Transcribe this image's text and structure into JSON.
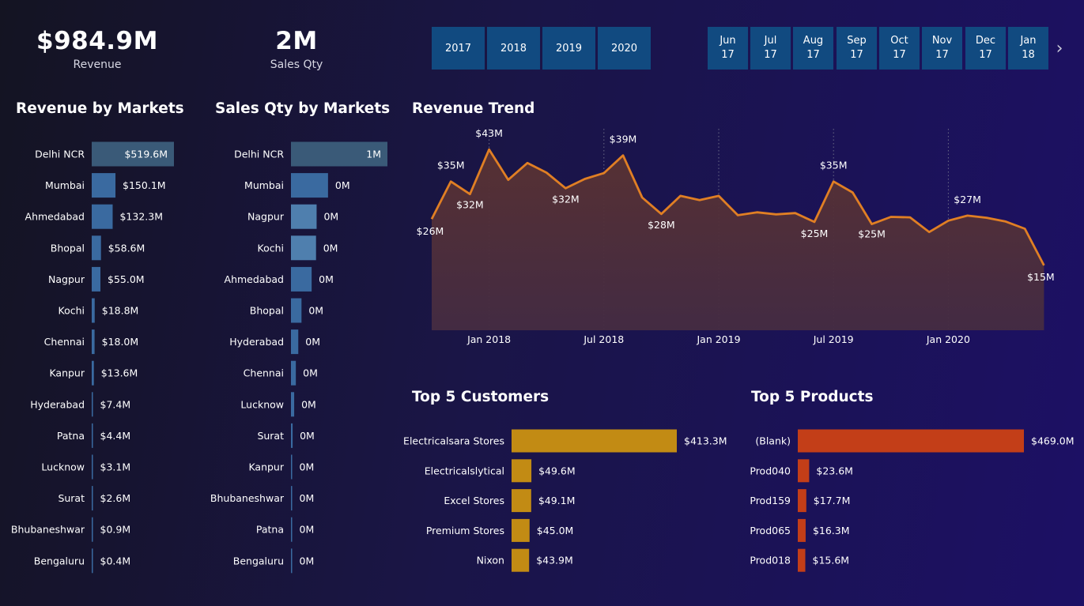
{
  "kpis": {
    "revenue": {
      "value": "$984.9M",
      "label": "Revenue"
    },
    "sales_qty": {
      "value": "2M",
      "label": "Sales Qty"
    }
  },
  "year_slicer": [
    "2017",
    "2018",
    "2019",
    "2020"
  ],
  "month_slicer": [
    {
      "month": "Jun",
      "year": "17"
    },
    {
      "month": "Jul",
      "year": "17"
    },
    {
      "month": "Aug",
      "year": "17"
    },
    {
      "month": "Sep",
      "year": "17"
    },
    {
      "month": "Oct",
      "year": "17"
    },
    {
      "month": "Nov",
      "year": "17"
    },
    {
      "month": "Dec",
      "year": "17"
    },
    {
      "month": "Jan",
      "year": "18"
    }
  ],
  "colors": {
    "market_bar_top": "#3a5a78",
    "market_bar": "#3a6aa0",
    "market_bar_light": "#4f7fae",
    "trend_line": "#e07f24",
    "trend_fill": "#4a2c3d",
    "customers_bar": "#c28b14",
    "products_bar": "#c33e18"
  },
  "chart_data": [
    {
      "type": "bar",
      "orientation": "horizontal",
      "title": "Revenue by Markets",
      "categories": [
        "Delhi NCR",
        "Mumbai",
        "Ahmedabad",
        "Bhopal",
        "Nagpur",
        "Kochi",
        "Chennai",
        "Kanpur",
        "Hyderabad",
        "Patna",
        "Lucknow",
        "Surat",
        "Bhubaneshwar",
        "Bengaluru"
      ],
      "values": [
        519.6,
        150.1,
        132.3,
        58.6,
        55.0,
        18.8,
        18.0,
        13.6,
        7.4,
        4.4,
        3.1,
        2.6,
        0.9,
        0.4
      ],
      "labels": [
        "$519.6M",
        "$150.1M",
        "$132.3M",
        "$58.6M",
        "$55.0M",
        "$18.8M",
        "$18.0M",
        "$13.6M",
        "$7.4M",
        "$4.4M",
        "$3.1M",
        "$2.6M",
        "$0.9M",
        "$0.4M"
      ]
    },
    {
      "type": "bar",
      "orientation": "horizontal",
      "title": "Sales Qty by Markets",
      "categories": [
        "Delhi NCR",
        "Mumbai",
        "Nagpur",
        "Kochi",
        "Ahmedabad",
        "Bhopal",
        "Hyderabad",
        "Chennai",
        "Lucknow",
        "Surat",
        "Kanpur",
        "Bhubaneshwar",
        "Patna",
        "Bengaluru"
      ],
      "values": [
        989000,
        380000,
        263000,
        257000,
        212000,
        108000,
        75000,
        50000,
        33000,
        17000,
        12000,
        8000,
        5000,
        3000
      ],
      "labels": [
        "1M",
        "0M",
        "0M",
        "0M",
        "0M",
        "0M",
        "0M",
        "0M",
        "0M",
        "0M",
        "0M",
        "0M",
        "0M",
        "0M"
      ]
    },
    {
      "type": "area",
      "title": "Revenue Trend",
      "x": [
        "2017-10",
        "2017-11",
        "2017-12",
        "2018-01",
        "2018-02",
        "2018-03",
        "2018-04",
        "2018-05",
        "2018-06",
        "2018-07",
        "2018-08",
        "2018-09",
        "2018-10",
        "2018-11",
        "2018-12",
        "2019-01",
        "2019-02",
        "2019-03",
        "2019-04",
        "2019-05",
        "2019-06",
        "2019-07",
        "2019-08",
        "2019-09",
        "2019-10",
        "2019-11",
        "2019-12",
        "2020-01",
        "2020-02",
        "2020-03",
        "2020-04",
        "2020-05",
        "2020-06"
      ],
      "y": [
        26.4,
        35.3,
        32.3,
        42.9,
        35.7,
        39.7,
        37.4,
        33.7,
        35.9,
        37.3,
        41.5,
        31.5,
        27.6,
        31.9,
        30.9,
        31.9,
        27.3,
        28.0,
        27.5,
        27.8,
        25.7,
        35.3,
        32.7,
        25.2,
        26.9,
        26.8,
        23.3,
        26.0,
        27.2,
        26.7,
        25.8,
        24.1,
        15.4
      ],
      "point_labels": [
        {
          "index": 0,
          "text": "$26M"
        },
        {
          "index": 1,
          "text": "$35M"
        },
        {
          "index": 2,
          "text": "$32M"
        },
        {
          "index": 3,
          "text": "$43M"
        },
        {
          "index": 7,
          "text": "$32M"
        },
        {
          "index": 10,
          "text": "$39M"
        },
        {
          "index": 12,
          "text": "$28M"
        },
        {
          "index": 20,
          "text": "$25M"
        },
        {
          "index": 21,
          "text": "$35M"
        },
        {
          "index": 23,
          "text": "$25M"
        },
        {
          "index": 28,
          "text": "$27M"
        },
        {
          "index": 32,
          "text": "$15M"
        }
      ],
      "x_ticks": [
        {
          "index": 3,
          "label": "Jan 2018"
        },
        {
          "index": 9,
          "label": "Jul 2018"
        },
        {
          "index": 15,
          "label": "Jan 2019"
        },
        {
          "index": 21,
          "label": "Jul 2019"
        },
        {
          "index": 27,
          "label": "Jan 2020"
        }
      ],
      "ylim": [
        0,
        45
      ],
      "grid": "vertical dotted"
    },
    {
      "type": "bar",
      "orientation": "horizontal",
      "title": "Top 5 Customers",
      "categories": [
        "Electricalsara Stores",
        "Electricalslytical",
        "Excel Stores",
        "Premium Stores",
        "Nixon"
      ],
      "values": [
        413.3,
        49.6,
        49.1,
        45.0,
        43.9
      ],
      "labels": [
        "$413.3M",
        "$49.6M",
        "$49.1M",
        "$45.0M",
        "$43.9M"
      ]
    },
    {
      "type": "bar",
      "orientation": "horizontal",
      "title": "Top 5 Products",
      "categories": [
        "(Blank)",
        "Prod040",
        "Prod159",
        "Prod065",
        "Prod018"
      ],
      "values": [
        469.0,
        23.6,
        17.7,
        16.3,
        15.6
      ],
      "labels": [
        "$469.0M",
        "$23.6M",
        "$17.7M",
        "$16.3M",
        "$15.6M"
      ]
    }
  ]
}
